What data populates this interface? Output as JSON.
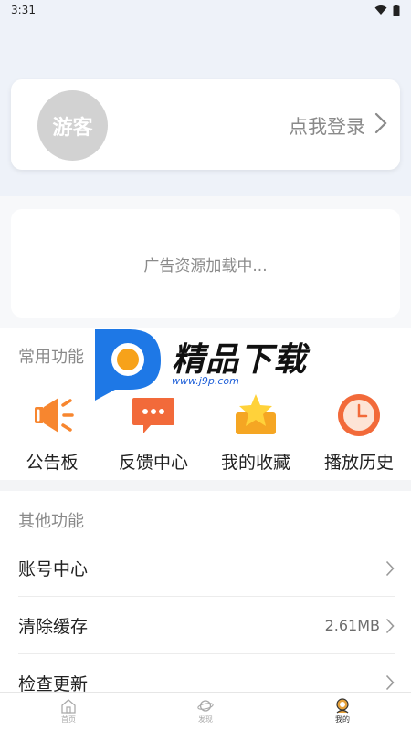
{
  "status": {
    "time": "3:31"
  },
  "login": {
    "avatar_text": "游客",
    "link": "点我登录"
  },
  "ad": {
    "loading_text": "广告资源加载中..."
  },
  "common": {
    "title": "常用功能",
    "items": [
      {
        "label": "公告板",
        "icon": "megaphone-icon"
      },
      {
        "label": "反馈中心",
        "icon": "chat-bubble-icon"
      },
      {
        "label": "我的收藏",
        "icon": "star-box-icon"
      },
      {
        "label": "播放历史",
        "icon": "clock-icon"
      }
    ]
  },
  "other": {
    "title": "其他功能",
    "rows": [
      {
        "label": "账号中心",
        "value": ""
      },
      {
        "label": "清除缓存",
        "value": "2.61MB"
      },
      {
        "label": "检查更新",
        "value": ""
      }
    ]
  },
  "nav": {
    "items": [
      {
        "label": "首页",
        "icon": "home-icon",
        "active": false
      },
      {
        "label": "发现",
        "icon": "planet-icon",
        "active": false
      },
      {
        "label": "我的",
        "icon": "profile-icon",
        "active": true
      }
    ]
  },
  "watermark": {
    "title": "精品下载",
    "url": "www.j9p.com"
  },
  "colors": {
    "accent_orange": "#f7862f",
    "background": "#eef2f9",
    "active_nav": "#e6a23c"
  }
}
